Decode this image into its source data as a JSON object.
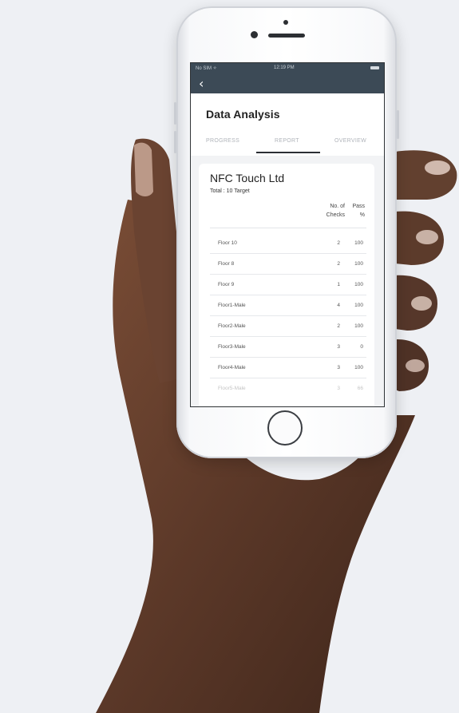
{
  "status_bar": {
    "carrier": "No SIM ✧",
    "time": "12:19 PM"
  },
  "nav": {
    "back_icon": "‹"
  },
  "page_title": "Data Analysis",
  "tabs": [
    {
      "label": "PROGRESS",
      "active": false
    },
    {
      "label": "REPORT",
      "active": true
    },
    {
      "label": "OVERVIEW",
      "active": false
    }
  ],
  "report": {
    "company": "NFC Touch Ltd",
    "total": "Total : 10 Target",
    "columns": {
      "checks": "No. of Checks",
      "pass": "Pass %"
    },
    "rows": [
      {
        "name": "Floor 10",
        "checks": "2",
        "pass": "100"
      },
      {
        "name": "Floor 8",
        "checks": "2",
        "pass": "100"
      },
      {
        "name": "Floor 9",
        "checks": "1",
        "pass": "100"
      },
      {
        "name": "Floor1-Male",
        "checks": "4",
        "pass": "100"
      },
      {
        "name": "Floor2-Male",
        "checks": "2",
        "pass": "100"
      },
      {
        "name": "Floor3-Male",
        "checks": "3",
        "pass": "0"
      },
      {
        "name": "Floor4-Male",
        "checks": "3",
        "pass": "100"
      },
      {
        "name": "Floor5-Male",
        "checks": "3",
        "pass": "66"
      }
    ]
  },
  "colors": {
    "nav_bg": "#3c4a56",
    "background": "#eef0f4",
    "skin": "#5a3a2a"
  }
}
